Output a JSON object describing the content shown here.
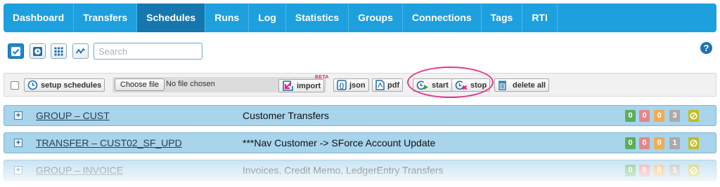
{
  "nav": {
    "items": [
      "Dashboard",
      "Transfers",
      "Schedules",
      "Runs",
      "Log",
      "Statistics",
      "Groups",
      "Connections",
      "Tags",
      "RTI"
    ],
    "active": "Schedules"
  },
  "toolbar": {
    "view_icons": [
      "checklist-view-icon",
      "clock-view-icon",
      "grid-view-icon",
      "activity-view-icon"
    ],
    "search_placeholder": "Search",
    "help_label": "?"
  },
  "actions": {
    "setup_label": "setup schedules",
    "choose_file_label": "Choose file",
    "no_file_label": "No file chosen",
    "import_label": "import",
    "beta_label": "BETA",
    "json_label": "json",
    "pdf_label": "pdf",
    "start_label": "start",
    "stop_label": "stop",
    "delete_all_label": "delete all"
  },
  "rows": [
    {
      "name": "GROUP – CUST",
      "description": "Customer Transfers",
      "counts": [
        "0",
        "0",
        "0",
        "3"
      ]
    },
    {
      "name": "TRANSFER – CUST02_SF_UPD",
      "description": "***Nav Customer -> SForce Account Update",
      "counts": [
        "0",
        "0",
        "0",
        "1"
      ]
    },
    {
      "name": "GROUP – INVOICE",
      "description": "Invoices, Credit Memo, LedgerEntry Transfers",
      "counts": [
        "0",
        "0",
        "0",
        "1"
      ]
    }
  ],
  "colors": {
    "nav_bg": "#1ea0df",
    "nav_active": "#1577ae",
    "row_bg": "#a8d4ec",
    "highlight_oval": "#e23a8a",
    "badge_green": "#5cae5a",
    "badge_red": "#e6868a",
    "badge_orange": "#efad52",
    "badge_gray": "#a9aaa9",
    "badge_olive": "#c3bd1f"
  }
}
